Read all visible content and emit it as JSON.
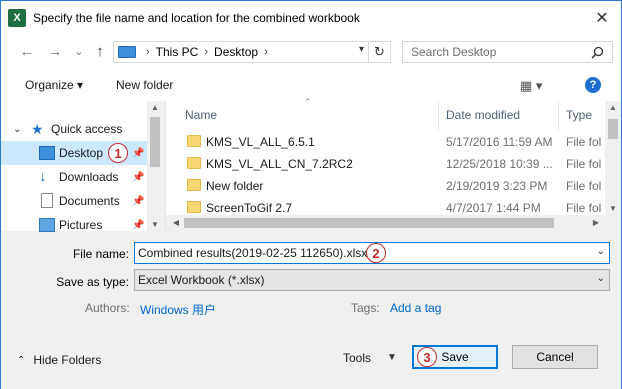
{
  "window": {
    "app_icon": "excel-icon",
    "app_icon_letter": "X",
    "title": "Specify the file name and location for the combined workbook",
    "close_glyph": "✕"
  },
  "nav": {
    "back_glyph": "←",
    "forward_glyph": "→",
    "history_glyph": "⌄",
    "up_glyph": "↑",
    "breadcrumbs": [
      "This PC",
      "Desktop"
    ],
    "crumb_separator": "›",
    "search_placeholder": "Search Desktop"
  },
  "toolbar": {
    "organize_label": "Organize ▾",
    "new_folder_label": "New folder",
    "view_glyph": "▦ ▾",
    "help_glyph": "?"
  },
  "sidebar": {
    "quick_access_label": "Quick access",
    "items": [
      {
        "label": "Desktop",
        "icon": "desktop-icon",
        "pinned": true,
        "selected": true
      },
      {
        "label": "Downloads",
        "icon": "downloads-icon",
        "pinned": true
      },
      {
        "label": "Documents",
        "icon": "documents-icon",
        "pinned": true
      },
      {
        "label": "Pictures",
        "icon": "pictures-icon",
        "pinned": true
      }
    ]
  },
  "file_list": {
    "columns": [
      "Name",
      "Date modified",
      "Type"
    ],
    "rows": [
      {
        "name": "KMS_VL_ALL_6.5.1",
        "date": "5/17/2016 11:59 AM",
        "type": "File fol"
      },
      {
        "name": "KMS_VL_ALL_CN_7.2RC2",
        "date": "12/25/2018 10:39 ...",
        "type": "File fol"
      },
      {
        "name": "New folder",
        "date": "2/19/2019 3:23 PM",
        "type": "File fol"
      },
      {
        "name": "ScreenToGif 2.7",
        "date": "4/7/2017 1:44 PM",
        "type": "File fol"
      }
    ]
  },
  "form": {
    "file_name_label": "File name:",
    "file_name_value": "Combined results(2019-02-25 112650).xlsx",
    "save_as_type_label": "Save as type:",
    "save_as_type_value": "Excel Workbook (*.xlsx)",
    "authors_label": "Authors:",
    "authors_value": "Windows 用户",
    "tags_label": "Tags:",
    "tags_value": "Add a tag"
  },
  "footer": {
    "hide_folders_label": "Hide Folders",
    "tools_label": "Tools",
    "save_label": "Save",
    "cancel_label": "Cancel"
  },
  "annotations": [
    "1",
    "2",
    "3"
  ],
  "colors": {
    "accent": "#0078d7",
    "selected": "#cce8ff",
    "badge": "#c62828",
    "folder": "#f8d775"
  }
}
